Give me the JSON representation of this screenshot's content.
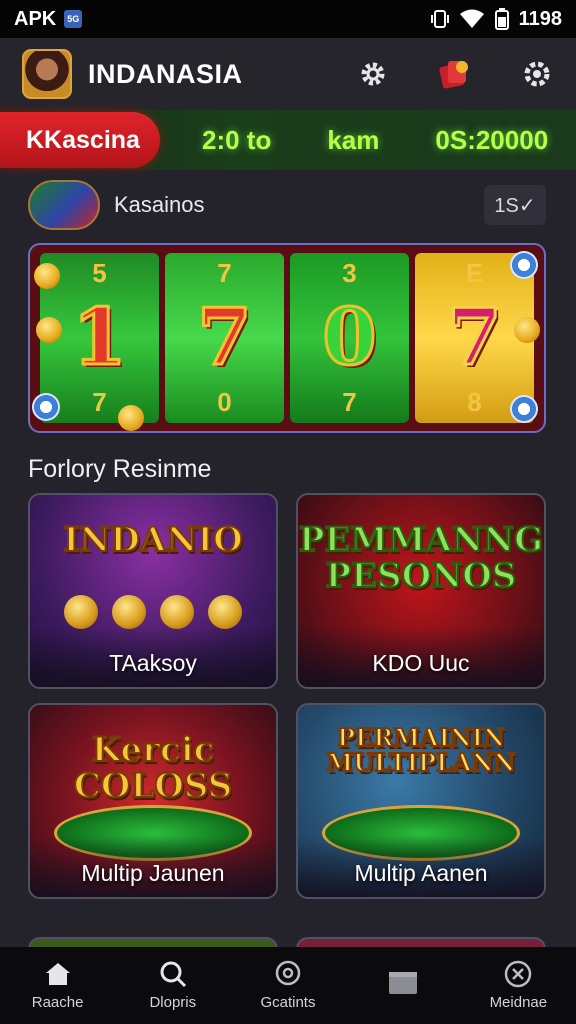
{
  "status_bar": {
    "carrier": "APK",
    "sim_badge": "5G",
    "time": "1198"
  },
  "header": {
    "title": "INDANASIA"
  },
  "ticker": {
    "badge": "KKascina",
    "items": [
      "2:0 to",
      "kam",
      "0S:20000"
    ]
  },
  "category_row": {
    "label": "Kasainos",
    "badge": "1S✓"
  },
  "banner": {
    "reels": [
      {
        "top": "5",
        "main": "1",
        "bottom": "7"
      },
      {
        "top": "7",
        "main": "7",
        "bottom": "0"
      },
      {
        "top": "3",
        "main": "0",
        "bottom": "7"
      },
      {
        "top": "E",
        "main": "7",
        "bottom": "8"
      }
    ]
  },
  "section": {
    "title": "Forlory Resinme"
  },
  "cards": [
    {
      "art": "INDANIO",
      "label": "TAaksoy"
    },
    {
      "art": "PEMMANNG PESONOS",
      "label": "KDO Uuc"
    },
    {
      "art": "Kercic COLOSS",
      "label": "Multip Jaunen"
    },
    {
      "art": "PERMAININ MULTIPLANN",
      "label": "Multip Aanen"
    }
  ],
  "bottom_nav": [
    {
      "label": "Raache",
      "icon": "home-icon"
    },
    {
      "label": "Dlopris",
      "icon": "search-icon"
    },
    {
      "label": "Gcatints",
      "icon": "chat-search-icon"
    },
    {
      "label": "",
      "icon": "folder-icon"
    },
    {
      "label": "Meidnae",
      "icon": "game-icon"
    }
  ],
  "colors": {
    "accent_red": "#d8232a",
    "ticker_green": "#b8ff4a",
    "background": "#24232b"
  }
}
